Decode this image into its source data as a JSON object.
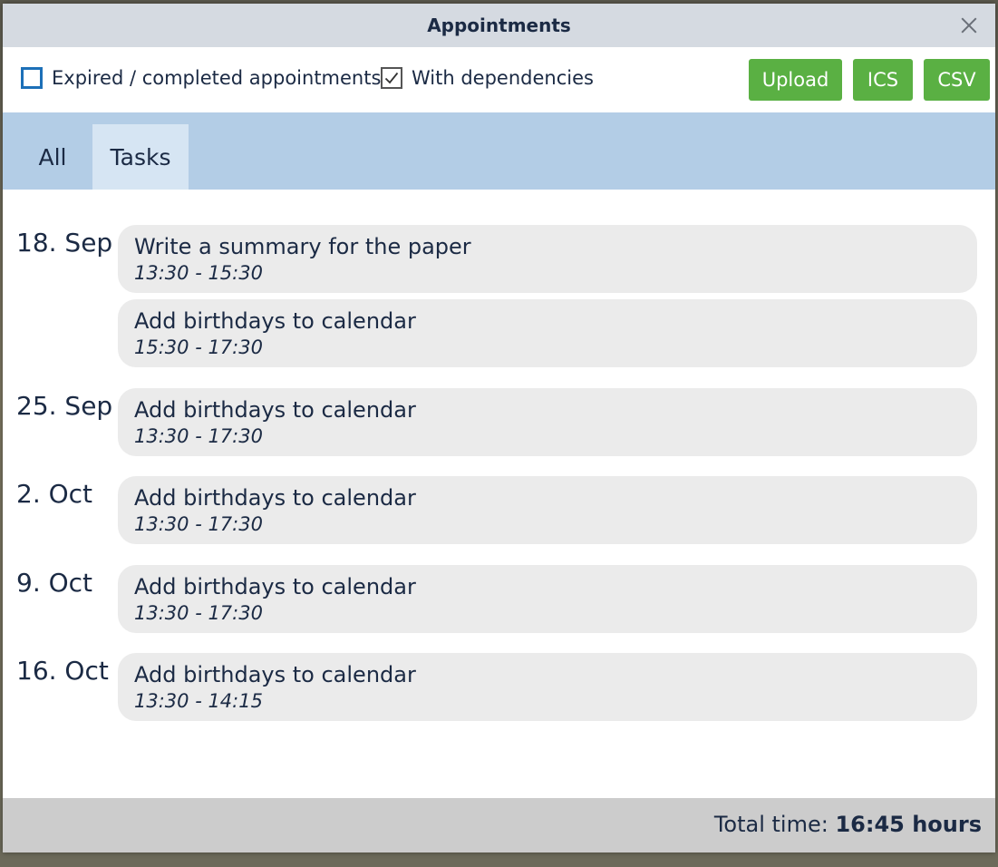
{
  "dialog": {
    "title": "Appointments",
    "close_icon": "close-icon"
  },
  "toolbar": {
    "expired_label": "Expired / completed appointments",
    "expired_checked": false,
    "dependencies_label": "With dependencies",
    "dependencies_checked": true,
    "upload_label": "Upload",
    "ics_label": "ICS",
    "csv_label": "CSV",
    "button_color": "#5ab043"
  },
  "tabs": [
    {
      "label": "All",
      "active": false
    },
    {
      "label": "Tasks",
      "active": true
    }
  ],
  "groups": [
    {
      "date": "18. Sep",
      "items": [
        {
          "title": "Write a summary for the paper",
          "time": "13:30 - 15:30"
        },
        {
          "title": "Add birthdays to calendar",
          "time": "15:30 - 17:30"
        }
      ]
    },
    {
      "date": "25. Sep",
      "items": [
        {
          "title": "Add birthdays to calendar",
          "time": "13:30 - 17:30"
        }
      ]
    },
    {
      "date": "2. Oct",
      "items": [
        {
          "title": "Add birthdays to calendar",
          "time": "13:30 - 17:30"
        }
      ]
    },
    {
      "date": "9. Oct",
      "items": [
        {
          "title": "Add birthdays to calendar",
          "time": "13:30 - 17:30"
        }
      ]
    },
    {
      "date": "16. Oct",
      "items": [
        {
          "title": "Add birthdays to calendar",
          "time": "13:30 - 14:15"
        }
      ]
    }
  ],
  "footer": {
    "total_label": "Total time:",
    "total_value": "16:45 hours"
  }
}
